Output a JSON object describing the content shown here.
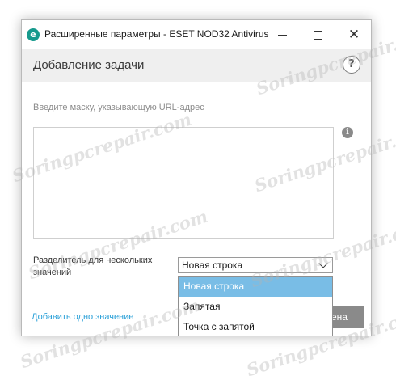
{
  "window": {
    "title": "Расширенные параметры - ESET NOD32 Antivirus",
    "logo_letter": "e"
  },
  "header": {
    "title": "Добавление задачи",
    "help_glyph": "?"
  },
  "form": {
    "mask_label": "Введите маску, указывающую URL-адрес",
    "info_glyph": "i",
    "separator_label": "Разделитель для нескольких значений",
    "separator_selected": "Новая строка",
    "separator_options": [
      "Новая строка",
      "Запятая",
      "Точка с запятой"
    ],
    "add_value_link": "Добавить одно значение",
    "cancel_partial": "ена"
  },
  "watermark_text": "Soringpcrepair.com",
  "colors": {
    "brand": "#179a8d",
    "selection": "#79bde6",
    "link": "#2aa0d8"
  }
}
